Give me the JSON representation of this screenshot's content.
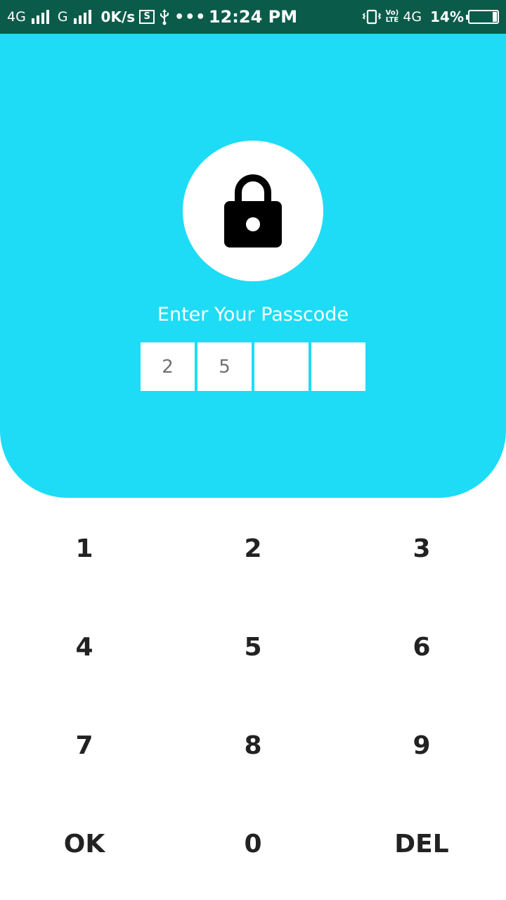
{
  "status_bar": {
    "net1": "4G",
    "net2": "G",
    "speed": "0K/s",
    "sim_label": "S",
    "time": "12:24 PM",
    "volte_top": "Vo)",
    "volte_bottom": "LTE",
    "net3": "4G",
    "battery": "14%",
    "battery_level": 0.14
  },
  "header": {
    "prompt": "Enter Your Passcode",
    "digits": [
      "2",
      "5",
      "",
      ""
    ]
  },
  "keypad": {
    "keys": [
      "1",
      "2",
      "3",
      "4",
      "5",
      "6",
      "7",
      "8",
      "9",
      "OK",
      "0",
      "DEL"
    ]
  },
  "colors": {
    "accent": "#1edcf5",
    "status_bar": "#0b5b4a",
    "key_text": "#222222"
  }
}
